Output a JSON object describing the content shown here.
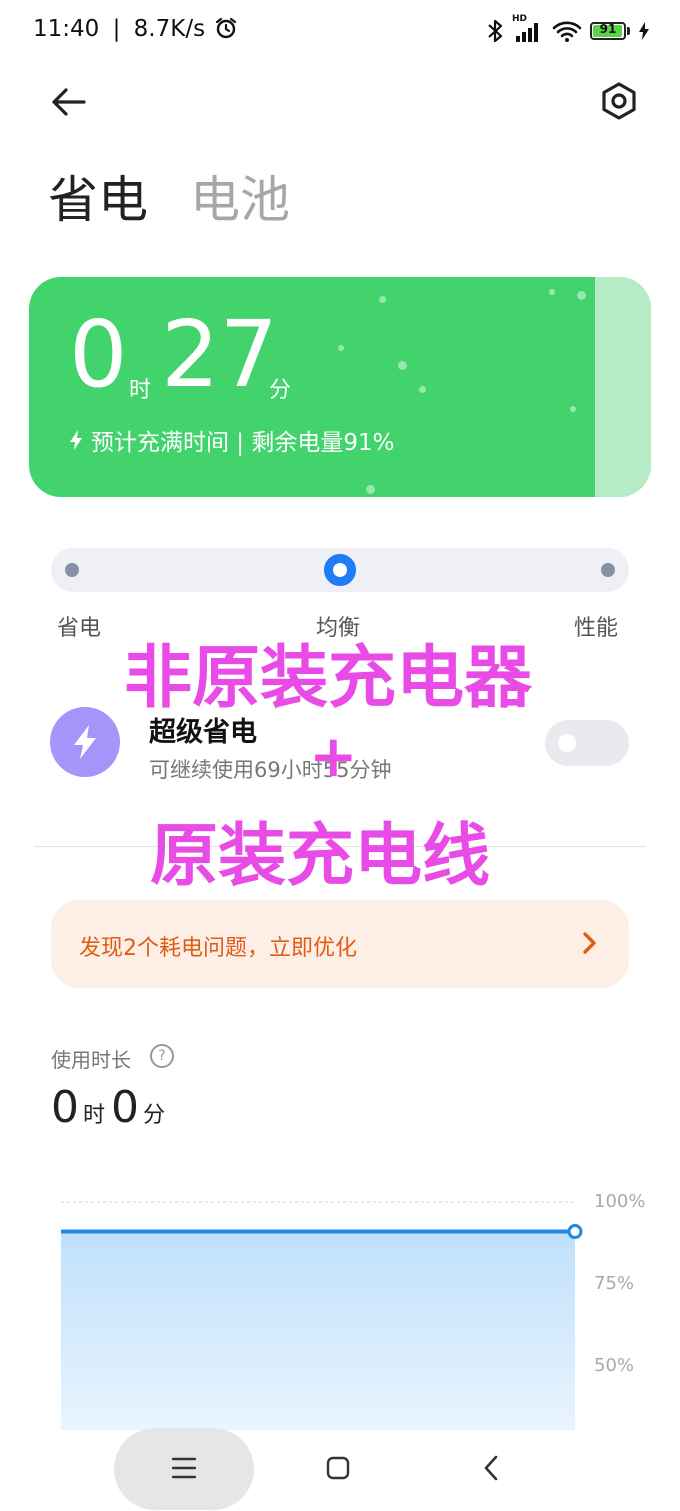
{
  "status_bar": {
    "time": "11:40",
    "net_speed": "8.7K/s",
    "network": "HD",
    "battery_level": "91",
    "battery_fraction": 0.91
  },
  "header": {
    "tab_power_saving": "省电",
    "tab_battery": "电池"
  },
  "charge_card": {
    "hours": "0",
    "hour_unit": "时",
    "minutes": "27",
    "minute_unit": "分",
    "subtitle": "预计充满时间 | 剩余电量91%",
    "accent_color": "#43d36c"
  },
  "mode_slider": {
    "options": [
      "省电",
      "均衡",
      "性能"
    ],
    "selected": "均衡"
  },
  "overlay": {
    "line1": "非原装充电器",
    "plus": "+",
    "line2": "原装充电线",
    "color": "#e94ce6"
  },
  "super_save": {
    "title": "超级省电",
    "subtitle": "可继续使用69小时55分钟",
    "enabled": false
  },
  "issue_banner": {
    "text": "发现2个耗电问题，立即优化"
  },
  "usage": {
    "label": "使用时长",
    "hours": "0",
    "hour_unit": "时",
    "minutes": "0",
    "minute_unit": "分"
  },
  "chart_data": {
    "type": "area",
    "y_ticks": [
      "100%",
      "75%",
      "50%"
    ],
    "ylim": [
      0,
      100
    ],
    "series": [
      {
        "values": [
          91,
          91
        ]
      }
    ],
    "color": "#1f8ae6",
    "grid": true
  },
  "nav": {
    "icons": [
      "menu-icon",
      "home-icon",
      "back-icon"
    ]
  }
}
